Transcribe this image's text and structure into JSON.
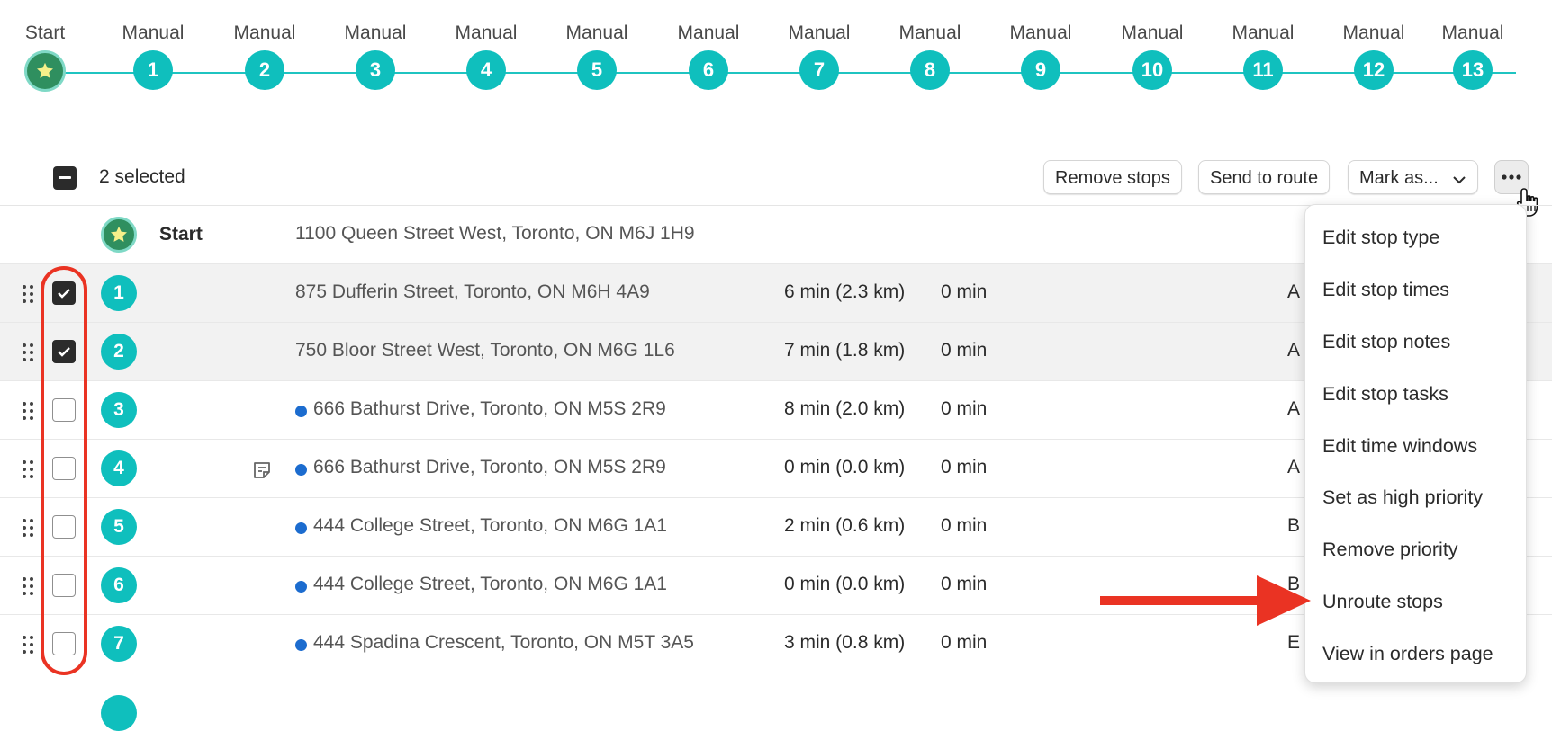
{
  "timeline": {
    "nodes": [
      {
        "label": "Start",
        "number": ""
      },
      {
        "label": "Manual",
        "number": "1"
      },
      {
        "label": "Manual",
        "number": "2"
      },
      {
        "label": "Manual",
        "number": "3"
      },
      {
        "label": "Manual",
        "number": "4"
      },
      {
        "label": "Manual",
        "number": "5"
      },
      {
        "label": "Manual",
        "number": "6"
      },
      {
        "label": "Manual",
        "number": "7"
      },
      {
        "label": "Manual",
        "number": "8"
      },
      {
        "label": "Manual",
        "number": "9"
      },
      {
        "label": "Manual",
        "number": "10"
      },
      {
        "label": "Manual",
        "number": "11"
      },
      {
        "label": "Manual",
        "number": "12"
      },
      {
        "label": "Manual",
        "number": "13"
      }
    ]
  },
  "toolbar": {
    "selected_count": "2 selected",
    "remove_stops": "Remove stops",
    "send_to_route": "Send to route",
    "mark_as": "Mark as..."
  },
  "stops": [
    {
      "number": "",
      "name": "Start",
      "address": "1100 Queen Street West, Toronto, ON M6J 1H9",
      "travel": "",
      "wait": "",
      "extra": "",
      "selected": false,
      "dot": false,
      "note": false,
      "start": true
    },
    {
      "number": "1",
      "name": "",
      "address": "875 Dufferin Street, Toronto, ON M6H 4A9",
      "travel": "6 min (2.3 km)",
      "wait": "0 min",
      "extra": "A",
      "selected": true,
      "dot": false,
      "note": false
    },
    {
      "number": "2",
      "name": "",
      "address": "750 Bloor Street West, Toronto, ON M6G 1L6",
      "travel": "7 min (1.8 km)",
      "wait": "0 min",
      "extra": "A",
      "selected": true,
      "dot": false,
      "note": false
    },
    {
      "number": "3",
      "name": "",
      "address": "666 Bathurst Drive, Toronto, ON M5S 2R9",
      "travel": "8 min (2.0 km)",
      "wait": "0 min",
      "extra": "A",
      "selected": false,
      "dot": true,
      "note": false
    },
    {
      "number": "4",
      "name": "",
      "address": "666 Bathurst Drive, Toronto, ON M5S 2R9",
      "travel": "0 min (0.0 km)",
      "wait": "0 min",
      "extra": "A",
      "selected": false,
      "dot": true,
      "note": true
    },
    {
      "number": "5",
      "name": "",
      "address": "444 College Street, Toronto, ON M6G 1A1",
      "travel": "2 min (0.6 km)",
      "wait": "0 min",
      "extra": "B",
      "selected": false,
      "dot": true,
      "note": false
    },
    {
      "number": "6",
      "name": "",
      "address": "444 College Street, Toronto, ON M6G 1A1",
      "travel": "0 min (0.0 km)",
      "wait": "0 min",
      "extra": "B",
      "selected": false,
      "dot": true,
      "note": false
    },
    {
      "number": "7",
      "name": "",
      "address": "444 Spadina Crescent, Toronto, ON M5T 3A5",
      "travel": "3 min (0.8 km)",
      "wait": "0 min",
      "extra": "E",
      "selected": false,
      "dot": true,
      "note": false
    }
  ],
  "menu": {
    "items": [
      "Edit stop type",
      "Edit stop times",
      "Edit stop notes",
      "Edit stop tasks",
      "Edit time windows",
      "Set as high priority",
      "Remove priority",
      "Unroute stops",
      "View in orders page"
    ]
  },
  "colors": {
    "teal": "#0fbfbd",
    "start_green": "#2f8f5f",
    "annotation_red": "#ea3323",
    "dot_blue": "#1c6ccf"
  }
}
